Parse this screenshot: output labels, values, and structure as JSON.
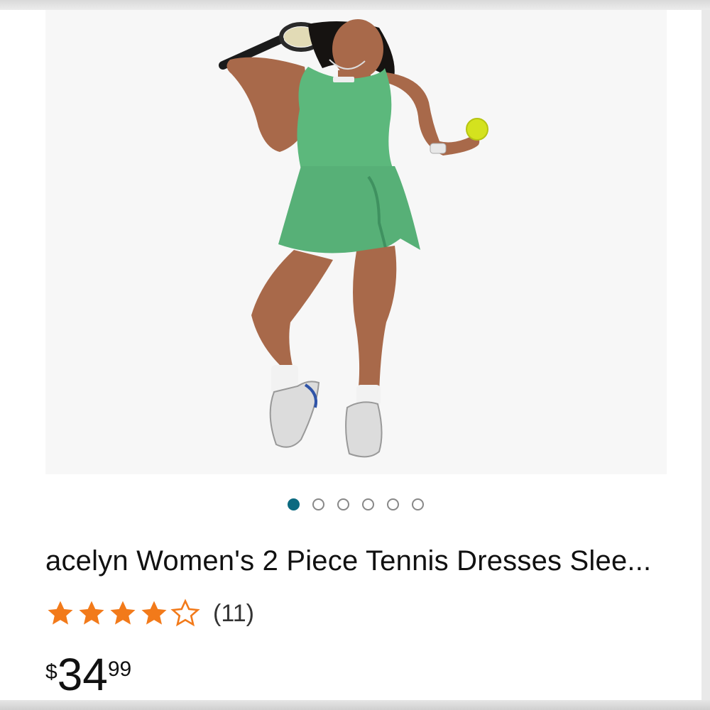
{
  "product": {
    "title": "acelyn Women's 2 Piece Tennis Dresses Slee...",
    "rating": {
      "value": 4.5,
      "max": 5,
      "count_label": "(11)"
    },
    "price": {
      "symbol": "$",
      "whole": "34",
      "fraction": "99"
    }
  },
  "carousel": {
    "total": 6,
    "active_index": 0
  },
  "image": {
    "icon": "product-photo-icon"
  },
  "colors": {
    "accent": "#0c6a80",
    "star": "#f27a1a",
    "dress": "#5cb87c"
  }
}
